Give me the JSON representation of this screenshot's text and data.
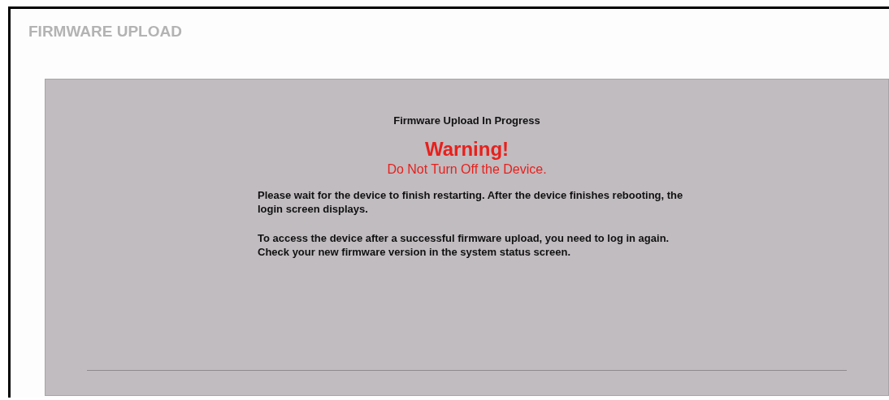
{
  "page": {
    "title": "FIRMWARE UPLOAD"
  },
  "panel": {
    "heading": "Firmware Upload In Progress",
    "warning": "Warning!",
    "warning_detail": "Do Not Turn Off the Device.",
    "paragraphs": [
      "Please wait for the device to finish restarting. After the device finishes rebooting, the login screen displays.",
      "To access the device after a successful firmware upload, you need to log in again. Check your new firmware version in the system status screen."
    ]
  }
}
